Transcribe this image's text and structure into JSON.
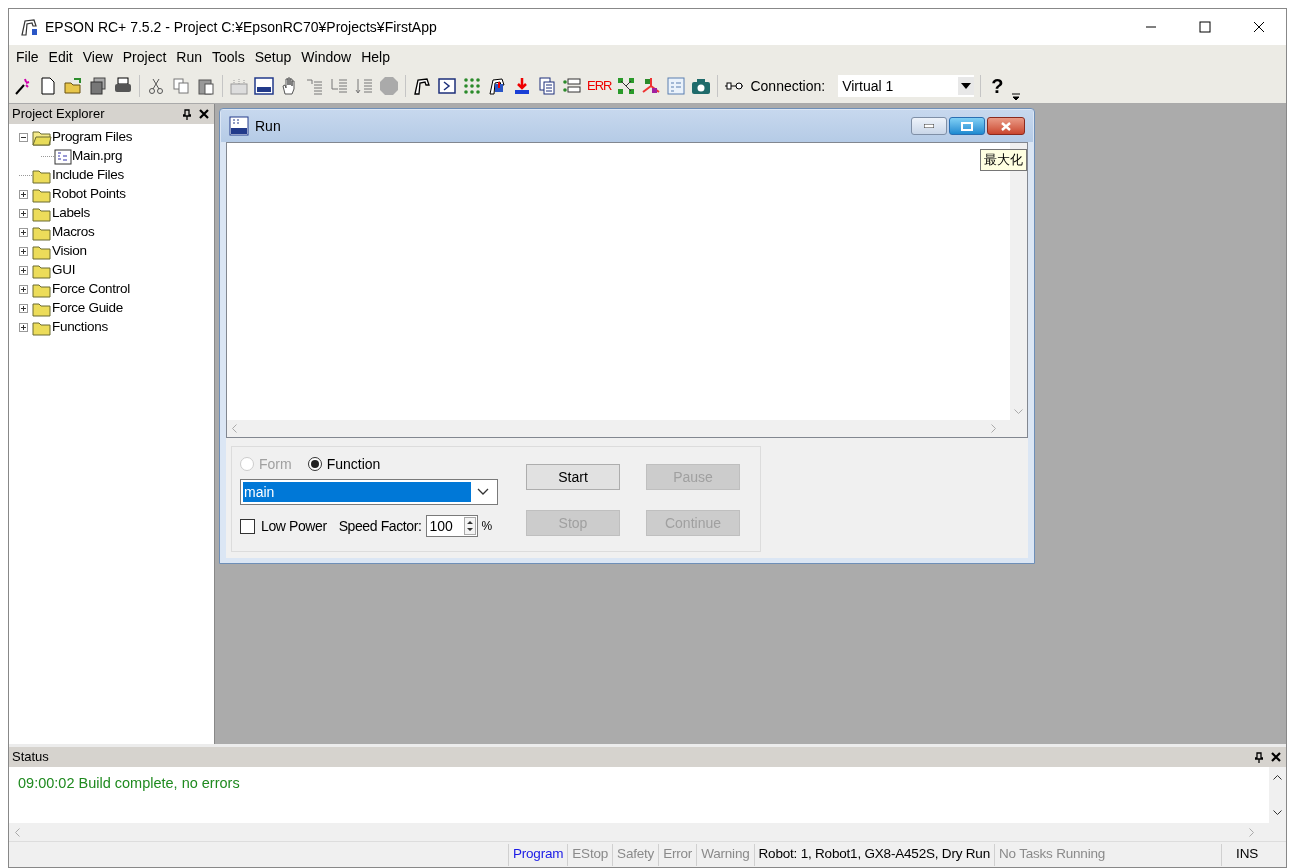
{
  "window": {
    "title": "EPSON RC+ 7.5.2 - Project C:¥EpsonRC70¥Projects¥FirstApp"
  },
  "menu": [
    "File",
    "Edit",
    "View",
    "Project",
    "Run",
    "Tools",
    "Setup",
    "Window",
    "Help"
  ],
  "toolbar": {
    "error_label": "ERR",
    "connection_label": "Connection:",
    "connection_value": "Virtual 1",
    "help": "?"
  },
  "project_explorer": {
    "title": "Project Explorer",
    "tree": [
      {
        "label": "Program Files",
        "kind": "folder",
        "expanded": true,
        "children": [
          {
            "label": "Main.prg",
            "kind": "file"
          }
        ]
      },
      {
        "label": "Include Files",
        "kind": "folder"
      },
      {
        "label": "Robot Points",
        "kind": "folder",
        "expanded": false
      },
      {
        "label": "Labels",
        "kind": "folder",
        "expanded": false
      },
      {
        "label": "Macros",
        "kind": "folder",
        "expanded": false
      },
      {
        "label": "Vision",
        "kind": "folder",
        "expanded": false
      },
      {
        "label": "GUI",
        "kind": "folder",
        "expanded": false
      },
      {
        "label": "Force Control",
        "kind": "folder",
        "expanded": false
      },
      {
        "label": "Force Guide",
        "kind": "folder",
        "expanded": false
      },
      {
        "label": "Functions",
        "kind": "folder",
        "expanded": false
      }
    ]
  },
  "run_window": {
    "title": "Run",
    "tooltip": "最大化",
    "options": [
      {
        "label": "Form",
        "selected": false,
        "disabled": true
      },
      {
        "label": "Function",
        "selected": true,
        "disabled": false
      }
    ],
    "function_value": "main",
    "low_power": {
      "label": "Low Power",
      "checked": false
    },
    "speed_label": "Speed Factor:",
    "speed_value": "100",
    "speed_unit": "%",
    "buttons": [
      {
        "label": "Start",
        "disabled": false
      },
      {
        "label": "Pause",
        "disabled": true
      },
      {
        "label": "Stop",
        "disabled": true
      },
      {
        "label": "Continue",
        "disabled": true
      }
    ]
  },
  "status_panel": {
    "title": "Status",
    "messages": [
      "09:00:02 Build complete, no errors"
    ]
  },
  "status_bar": [
    {
      "text": "Program",
      "kind": "active"
    },
    {
      "text": "EStop",
      "kind": "off"
    },
    {
      "text": "Safety",
      "kind": "off"
    },
    {
      "text": "Error",
      "kind": "off"
    },
    {
      "text": "Warning",
      "kind": "off"
    },
    {
      "text": "Robot: 1, Robot1, GX8-A452S, Dry Run",
      "kind": "normal"
    },
    {
      "text": "No Tasks Running",
      "kind": "off"
    },
    {
      "text": "INS",
      "kind": "normal"
    }
  ]
}
